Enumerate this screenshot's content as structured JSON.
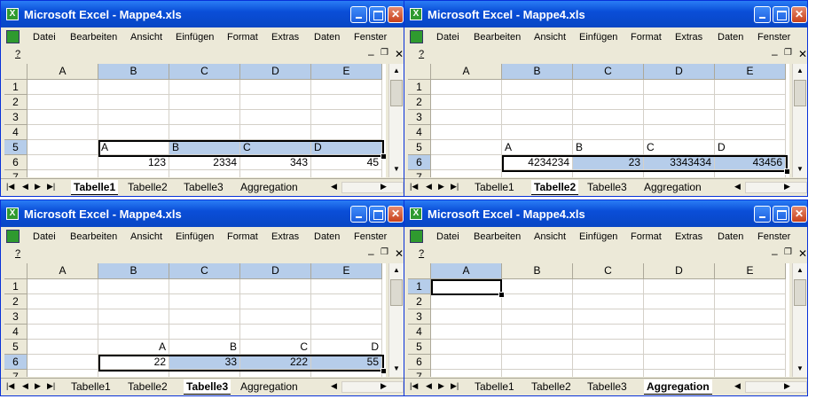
{
  "windows": [
    {
      "title": "Microsoft Excel - Mappe4.xls",
      "menu": [
        "Datei",
        "Bearbeiten",
        "Ansicht",
        "Einfügen",
        "Format",
        "Extras",
        "Daten",
        "Fenster"
      ],
      "help": "?",
      "columns": [
        "A",
        "B",
        "C",
        "D",
        "E"
      ],
      "selected_columns": [
        "B",
        "C",
        "D",
        "E"
      ],
      "rows": [
        "1",
        "2",
        "3",
        "4",
        "5",
        "6",
        "7"
      ],
      "selected_row": "5",
      "cells": {
        "r5": [
          "",
          "A",
          "B",
          "C",
          "D"
        ],
        "r6": [
          "",
          "123",
          "2334",
          "343",
          "45"
        ]
      },
      "tabs": [
        "Tabelle1",
        "Tabelle2",
        "Tabelle3",
        "Aggregation"
      ],
      "active_tab": "Tabelle1"
    },
    {
      "title": "Microsoft Excel - Mappe4.xls",
      "menu": [
        "Datei",
        "Bearbeiten",
        "Ansicht",
        "Einfügen",
        "Format",
        "Extras",
        "Daten",
        "Fenster"
      ],
      "help": "?",
      "columns": [
        "A",
        "B",
        "C",
        "D",
        "E"
      ],
      "selected_columns": [
        "B",
        "C",
        "D",
        "E"
      ],
      "rows": [
        "1",
        "2",
        "3",
        "4",
        "5",
        "6",
        "7"
      ],
      "selected_row": "6",
      "cells": {
        "r5": [
          "",
          "A",
          "B",
          "C",
          "D"
        ],
        "r6": [
          "",
          "4234234",
          "23",
          "3343434",
          "43456"
        ]
      },
      "tabs": [
        "Tabelle1",
        "Tabelle2",
        "Tabelle3",
        "Aggregation"
      ],
      "active_tab": "Tabelle2"
    },
    {
      "title": "Microsoft Excel - Mappe4.xls",
      "menu": [
        "Datei",
        "Bearbeiten",
        "Ansicht",
        "Einfügen",
        "Format",
        "Extras",
        "Daten",
        "Fenster"
      ],
      "help": "?",
      "columns": [
        "A",
        "B",
        "C",
        "D",
        "E"
      ],
      "selected_columns": [
        "B",
        "C",
        "D",
        "E"
      ],
      "rows": [
        "1",
        "2",
        "3",
        "4",
        "5",
        "6",
        "7"
      ],
      "selected_row": "6",
      "cells": {
        "r5": [
          "",
          "A",
          "B",
          "C",
          "D"
        ],
        "r6": [
          "",
          "22",
          "33",
          "222",
          "55"
        ]
      },
      "tabs": [
        "Tabelle1",
        "Tabelle2",
        "Tabelle3",
        "Aggregation"
      ],
      "active_tab": "Tabelle3"
    },
    {
      "title": "Microsoft Excel - Mappe4.xls",
      "menu": [
        "Datei",
        "Bearbeiten",
        "Ansicht",
        "Einfügen",
        "Format",
        "Extras",
        "Daten",
        "Fenster"
      ],
      "help": "?",
      "columns": [
        "A",
        "B",
        "C",
        "D",
        "E"
      ],
      "selected_columns": [
        "A"
      ],
      "rows": [
        "1",
        "2",
        "3",
        "4",
        "5",
        "6",
        "7"
      ],
      "selected_row": "1",
      "cells": {
        "r5": [
          "",
          "",
          "",
          "",
          ""
        ],
        "r6": [
          "",
          "",
          "",
          "",
          ""
        ]
      },
      "tabs": [
        "Tabelle1",
        "Tabelle2",
        "Tabelle3",
        "Aggregation"
      ],
      "active_tab": "Aggregation"
    }
  ],
  "colors": {
    "title_bar": "#0a4ed8",
    "selection_fill": "#b6cdea",
    "chrome": "#ece9d8"
  }
}
